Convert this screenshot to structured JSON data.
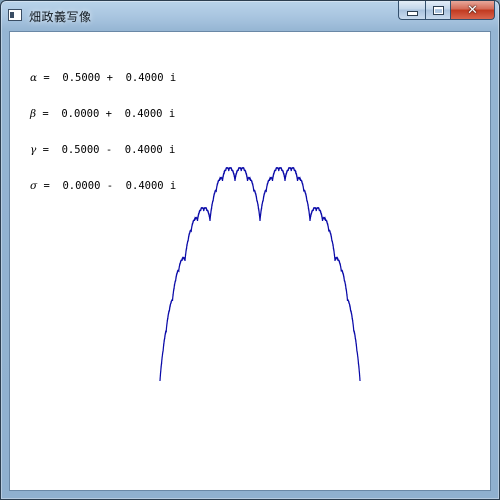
{
  "window": {
    "title": "畑政義写像",
    "minimize_glyph": "minimize",
    "maximize_glyph": "maximize",
    "close_glyph": "✕"
  },
  "parameters": [
    {
      "symbol": "α",
      "text": " =  0.5000 +  0.4000 i"
    },
    {
      "symbol": "β",
      "text": " =  0.0000 +  0.4000 i"
    },
    {
      "symbol": "γ",
      "text": " =  0.5000 -  0.4000 i"
    },
    {
      "symbol": "σ",
      "text": " =  0.0000 -  0.4000 i"
    }
  ],
  "plot": {
    "curve_color": "#0a0aa8",
    "alpha": [
      0.5,
      0.4
    ],
    "beta": [
      0.0,
      0.4
    ],
    "gamma": [
      0.5,
      -0.4
    ],
    "delta": [
      0.0,
      -0.4
    ],
    "iterations": 14
  },
  "colors": {
    "client_background": "#ffffff",
    "close_button": "#c1391f"
  }
}
